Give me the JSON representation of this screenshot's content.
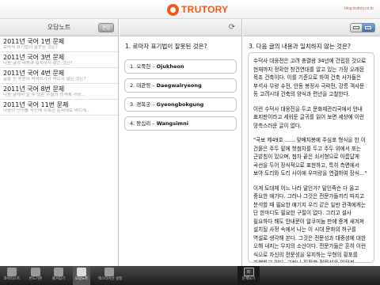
{
  "header": {
    "brand": "TRUTORY",
    "site_url": "blog.trutory.co.kr"
  },
  "left_panel": {
    "title": "오답노트",
    "edit_label": "편집",
    "items": [
      {
        "title": "2011년 국어 1번 문제",
        "sub": "로마자 표기법이 잘못된 것은?"
      },
      {
        "title": "2011년 국어 3번 문제",
        "sub": "다음 글의 내용과 일치하지 않는 것은?"
      },
      {
        "title": "2011년 국어 4번 문제",
        "sub": "글을 친 부분의 띄어쓰기가 바르지 않은 것은?"
      },
      {
        "title": "2011년 국어 8번 문제",
        "sub": "다음 글에서 알 수 있는 수필의 성격에 가장..."
      },
      {
        "title": "2011년 국어 11번 문제",
        "sub": "다음의 단어를 사전에 수록한 순서대로 바르게..."
      }
    ]
  },
  "middle_panel": {
    "question": "1. 로마자 표기법이 잘못된 것은?",
    "options": [
      {
        "num": "1. 오죽헌 –",
        "text": "Ojukheon"
      },
      {
        "num": "2. 대관령 –",
        "text": "Daegwalryeong"
      },
      {
        "num": "3. 경복궁 –",
        "text": "Gyeongbokgung"
      },
      {
        "num": "4. 왕십리 –",
        "text": "Wangsimni"
      }
    ]
  },
  "right_panel": {
    "question": "3. 다음 글의 내용과 일치하지 않는 것은?",
    "paragraphs": [
      "수덕사 대웅전은 고려 충렬왕 34년에 건립된 것으로 현재까지 정확한 창건연대를 알고 있는 가장 오래된 목조 건축이다. 이를 기준으로 하여 건축 사가들은 부석사 무량 수전, 안동 봉정사 극락전, 강릉 객사문 등 고려시대 건축의 양식과 편년을 고찰한다.",
      "이런 수덕사 대웅전을 두고 문화재관리국에서 안내 표지판이라고 세워둔 글귀를 읽어 보면 세상에 이런 망측스러운 글이 없다.",
      "\"국보 제49호 ...... 맞배지붕에 주심포 형식을 한 이 건물은 주두 밑에 헛첨차를 두고 주두 위에서 포는 근밭침이 있으며, 첨차 끝은 쇠서형으로 아름답게 곡선을 두어 장식적으로 표현하고, 특히 측면에서 보아 도리와 도리 사이에 우미량을 연결하여 장식...\"",
      "이게 도대체 어느 나라 말인가? 말인즉슨 다 옳고 중요한 얘기다. 그러나 그것은 전문가들끼리 따지고 분석할 때 필요한 얘기지 우리 같은 일반 관객에게는 단 한마디도 필요한 구절이 없다. 그리고 설사 필요하다 해도 안내문이 알쿠미늄 판에 중계 새겨져 설치될 사정 속에서 나는 이 시대 문화의 허구를 역설로 생각해 본다. 그것은 전문성과 대중성에 대한 오해 내지는 무지의 소산이다. 전문가들은 혼히 이런 식으로 자신의 전문성을 유지하는 무형의 횡포를 자행하고 있다. 그러나 진정한 전문성은 아무리 어렵고 전문적인 것이라도 그것을 대중적 차원에서 풀어서 보이는 데 있는 것이다."
    ]
  },
  "tabbar": {
    "tabs": [
      {
        "label": "과목리스트"
      },
      {
        "label": "반도기준"
      },
      {
        "label": "즐겨찾기"
      },
      {
        "label": "오답노트"
      },
      {
        "label": "텍스터이선 설정"
      }
    ],
    "center_label": "문제보기",
    "center_icon_char": "≡"
  }
}
